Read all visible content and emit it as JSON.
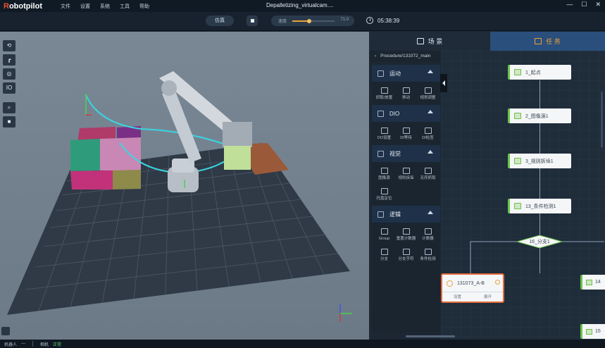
{
  "app": {
    "logo_r": "R",
    "logo_rest": "obotpilot",
    "window_title": "Depalletizing_virtualcam....",
    "menu": [
      "文件",
      "设置",
      "系统",
      "工具",
      "帮助"
    ],
    "window_controls": {
      "minimize": "—",
      "maximize": "☐",
      "close": "✕"
    }
  },
  "toolbar": {
    "mode": "仿真",
    "speed_label": "速度",
    "speed_value": "71.0",
    "speed_fraction": 0.4,
    "clock_time": "05:38:39"
  },
  "viewport": {
    "tools": [
      "reset-view-icon",
      "robot-pose-icon",
      "refresh-icon",
      "IO",
      "zoom-icon",
      "cube-view-icon"
    ],
    "io_label": "IO"
  },
  "tabs": {
    "scene_label": "场 景",
    "task_label": "任 务"
  },
  "procedure": {
    "path": "Procedure/131072_main"
  },
  "palette": {
    "sections": [
      {
        "title": "运动",
        "items": [
          "抓取/放置",
          "移动",
          "规划调整"
        ]
      },
      {
        "title": "DIO",
        "items": [
          "DO设置",
          "DI等待",
          "DI检查"
        ]
      },
      {
        "title": "视觉",
        "items": [
          "图像源",
          "规则拆垛",
          "无序抓取",
          "托盘定位"
        ]
      },
      {
        "title": "逻辑",
        "items": [
          "Group",
          "重置计数器",
          "计数器",
          "分支",
          "分支字符",
          "条件检测"
        ]
      }
    ]
  },
  "flow": {
    "nodes": [
      "1_起点",
      "2_图像源1",
      "3_规则拆垛1",
      "13_条件检测1"
    ],
    "diamond": "16_分支1",
    "branch_node": {
      "title": "131073_A-B",
      "left_action": "设置",
      "right_action": "展开"
    },
    "edge_nodes": [
      "14",
      "15"
    ]
  },
  "status": {
    "robot_label": "机器人",
    "robot_value": "---",
    "camera_label": "相机",
    "camera_value": "正常"
  }
}
